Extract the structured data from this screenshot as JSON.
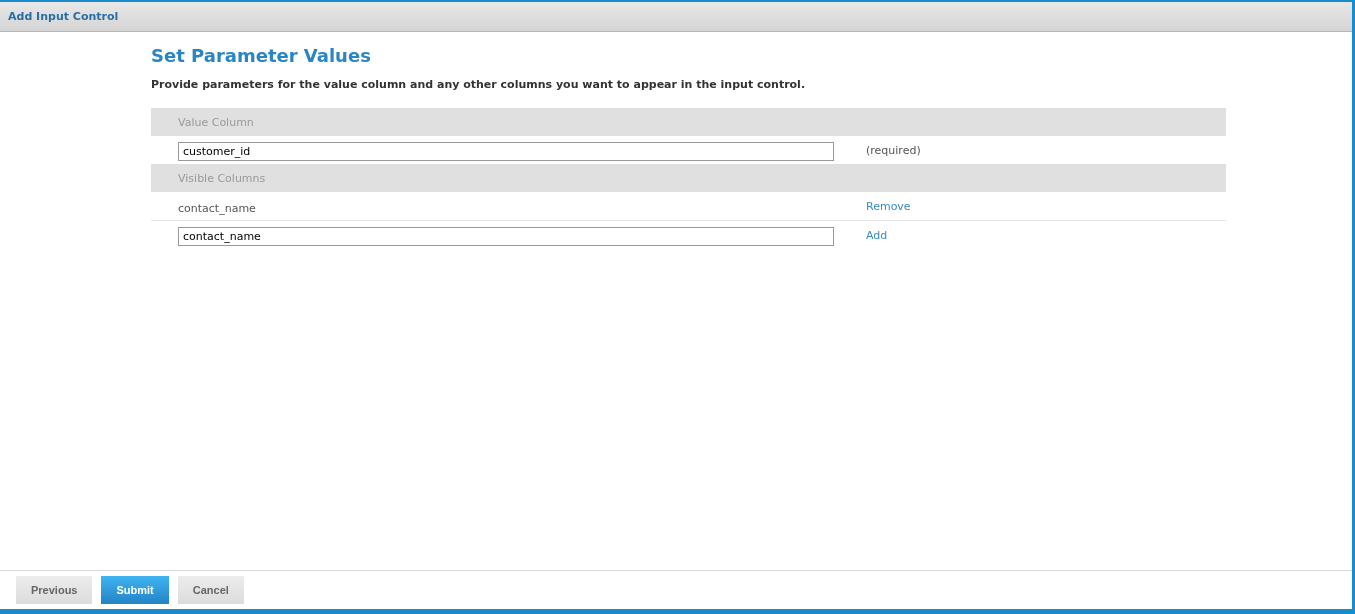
{
  "window": {
    "title": "Add Input Control"
  },
  "heading": "Set Parameter Values",
  "instructions": "Provide parameters for the value column and any other columns you want to appear in the input control.",
  "sections": [
    {
      "header": "Value Column",
      "rows": [
        {
          "kind": "input",
          "value": "customer_id",
          "aside": {
            "kind": "note",
            "text": "(required)"
          }
        }
      ]
    },
    {
      "header": "Visible Columns",
      "rows": [
        {
          "kind": "text",
          "text": "contact_name",
          "aside": {
            "kind": "link",
            "text": "Remove"
          }
        },
        {
          "kind": "input",
          "value": "contact_name",
          "aside": {
            "kind": "link",
            "text": "Add"
          }
        }
      ]
    }
  ],
  "buttons": [
    {
      "label": "Previous",
      "kind": "secondary"
    },
    {
      "label": "Submit",
      "kind": "primary"
    },
    {
      "label": "Cancel",
      "kind": "secondary"
    }
  ]
}
